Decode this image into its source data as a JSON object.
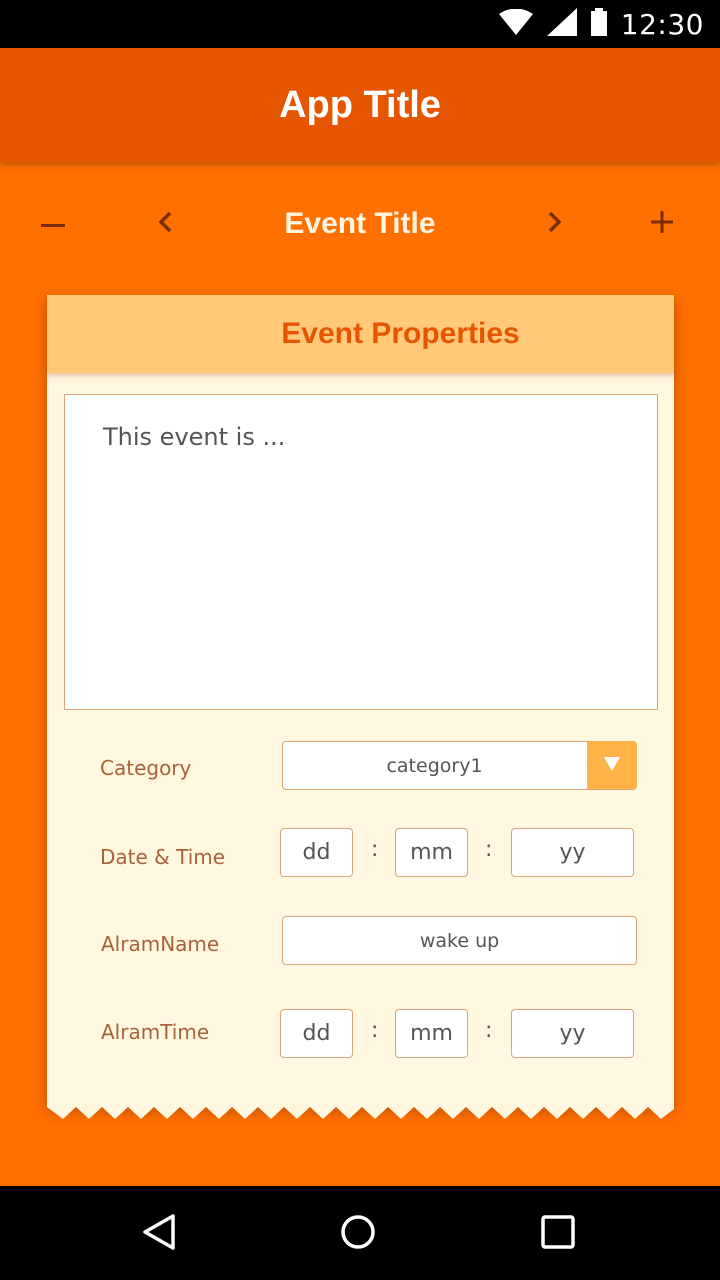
{
  "status_bar": {
    "time": "12:30",
    "icons": [
      "wifi-icon",
      "signal-icon",
      "battery-icon"
    ]
  },
  "app_bar": {
    "title": "App Title"
  },
  "event_nav": {
    "title": "Event Title",
    "icons": [
      "minus-icon",
      "chevron-left-icon",
      "chevron-right-icon",
      "plus-icon"
    ]
  },
  "card": {
    "header": "Event Properties",
    "description_placeholder": "This event is ...",
    "category": {
      "label": "Category",
      "value": "category1"
    },
    "datetime": {
      "label": "Date & Time",
      "dd": "dd",
      "mm": "mm",
      "yy": "yy",
      "separator": ":"
    },
    "alarm_name": {
      "label": "AlramName",
      "value": "wake up"
    },
    "alarm_time": {
      "label": "AlramTime",
      "dd": "dd",
      "mm": "mm",
      "yy": "yy",
      "separator": ":"
    }
  },
  "system_nav": {
    "icons": [
      "back-icon",
      "home-icon",
      "recents-icon"
    ]
  },
  "colors": {
    "status_bar": "#000000",
    "app_bar": "#e65500",
    "background": "#ff7000",
    "card_header": "#ffc978",
    "card_body": "#fff7e0",
    "accent": "#ffb347"
  }
}
